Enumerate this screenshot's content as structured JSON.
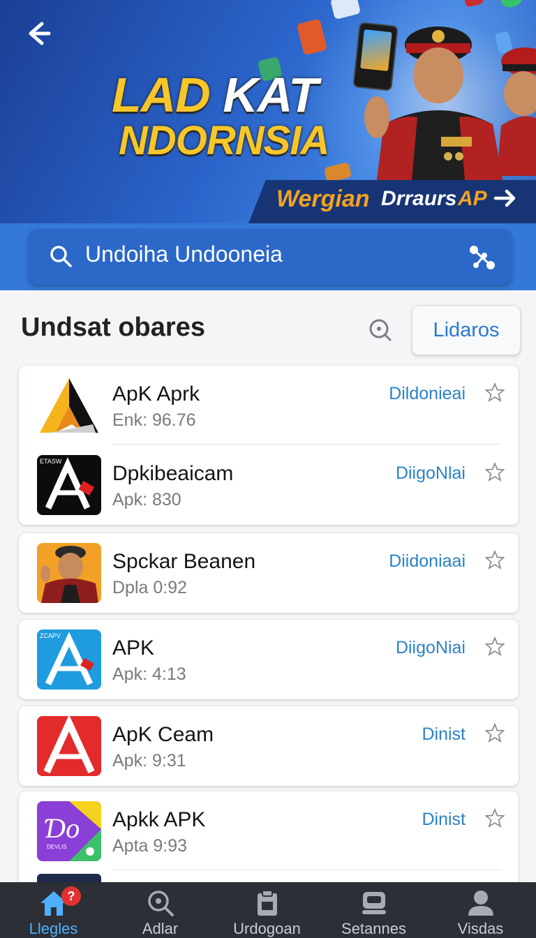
{
  "hero": {
    "title_part1": "LAD ",
    "title_part2": "KAT",
    "title_line2": "NDORNSIA",
    "cta_part1": "Wergian",
    "cta_part2": "Drraurs",
    "cta_part3": "AP"
  },
  "search": {
    "query": "Undoiha Undooneia"
  },
  "section": {
    "title": "Undsat obares",
    "filter_button": "Lidaros"
  },
  "apps": [
    {
      "name": "ApK Aprk",
      "subtitle": "Enk: 96.76",
      "action": "Dildonieai"
    },
    {
      "name": "Dpkibeaicam",
      "subtitle": "Apk: 830",
      "action": "DiigoNlai"
    },
    {
      "name": "Spckar Beanen",
      "subtitle": "Dpla 0:92",
      "action": "Diidoniaai"
    },
    {
      "name": "APK",
      "subtitle": "Apk: 4:13",
      "action": "DiigoNiai"
    },
    {
      "name": "ApK Ceam",
      "subtitle": "Apk: 9:31",
      "action": "Dinist"
    },
    {
      "name": "Apkk APK",
      "subtitle": "Apta 9:93",
      "action": "Dinist"
    }
  ],
  "icon_texts": {
    "app2_corner": "ETASW",
    "app4_corner": "ZCAPV",
    "app6_text": "DEVLIS"
  },
  "bottom_nav": {
    "items": [
      {
        "label": "Llegles",
        "icon": "home-icon"
      },
      {
        "label": "Adlar",
        "icon": "search-badge-icon"
      },
      {
        "label": "Urdogoan",
        "icon": "clipboard-icon"
      },
      {
        "label": "Setannes",
        "icon": "chat-icon"
      },
      {
        "label": "Visdas",
        "icon": "user-icon"
      }
    ],
    "badge": "?"
  },
  "colors": {
    "hero_blue": "#2a63c9",
    "accent_yellow": "#f7c62a",
    "link_blue": "#2a82c8",
    "nav_bg": "#2c2f35",
    "nav_active": "#4fb0ff"
  }
}
